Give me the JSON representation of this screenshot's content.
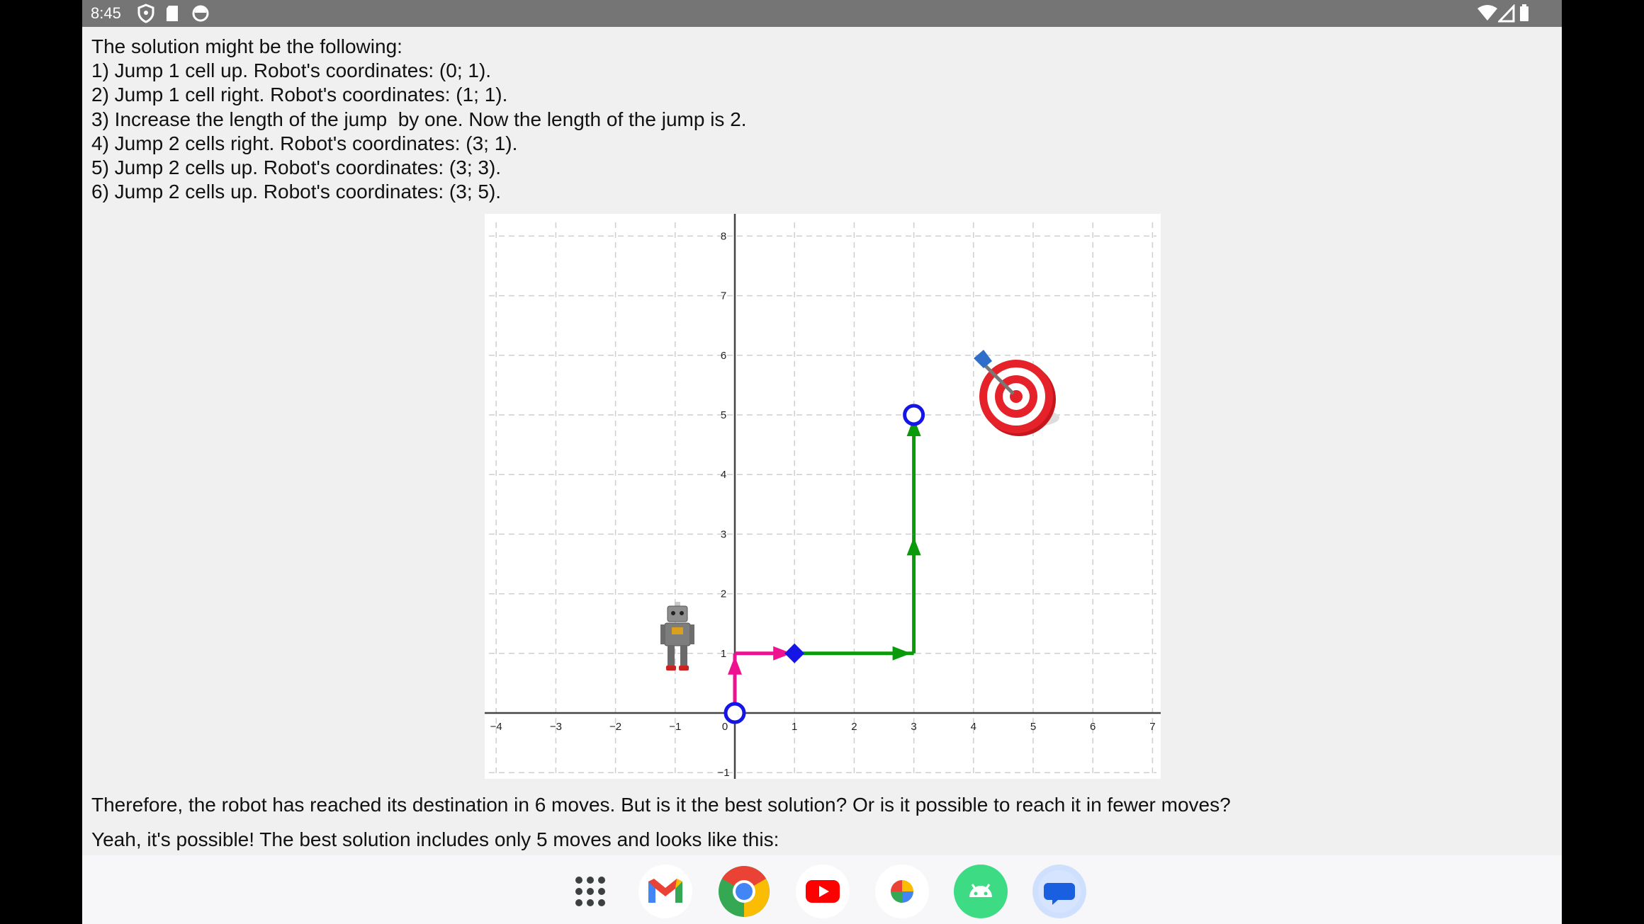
{
  "status": {
    "time": "8:45",
    "left_icons": [
      "shield-icon",
      "sd-card-icon",
      "sync-icon"
    ],
    "right_icons": [
      "wifi-icon",
      "signal-icon",
      "battery-icon"
    ]
  },
  "text": {
    "lines": [
      "The solution might be the following:",
      "1) Jump 1 cell up. Robot's coordinates: (0; 1).",
      "2) Jump 1 cell right. Robot's coordinates: (1; 1).",
      "3) Increase the length of the jump  by one. Now the length of the jump is 2.",
      "4) Jump 2 cells right. Robot's coordinates: (3; 1).",
      "5) Jump 2 cells up. Robot's coordinates: (3; 3).",
      "6) Jump 2 cells up. Robot's coordinates: (3; 5)."
    ],
    "conclusion": "Therefore, the robot has reached its destination in 6 moves. But is it the best solution? Or is it possible to reach it in fewer moves?",
    "cut_line": "Yeah, it's possible! The best solution includes only 5 moves and looks like this:"
  },
  "graph": {
    "x_ticks": [
      "-4",
      "-3",
      "-2",
      "-1",
      "0",
      "1",
      "2",
      "3",
      "4",
      "5",
      "6",
      "7"
    ],
    "y_ticks": [
      "-1",
      "1",
      "2",
      "3",
      "4",
      "5",
      "6",
      "7",
      "8"
    ],
    "path_colors": {
      "first_moves": "#ee1190",
      "later_moves": "#0a9a0a",
      "markers": "#1515e6"
    },
    "moves": [
      {
        "from": [
          0,
          0
        ],
        "to": [
          0,
          1
        ],
        "color": "first_moves"
      },
      {
        "from": [
          0,
          1
        ],
        "to": [
          1,
          1
        ],
        "color": "first_moves"
      },
      {
        "from": [
          1,
          1
        ],
        "to": [
          3,
          1
        ],
        "color": "later_moves"
      },
      {
        "from": [
          3,
          1
        ],
        "to": [
          3,
          3
        ],
        "color": "later_moves"
      },
      {
        "from": [
          3,
          3
        ],
        "to": [
          3,
          5
        ],
        "color": "later_moves"
      }
    ],
    "start_point": [
      0,
      0
    ],
    "end_point": [
      3,
      5
    ],
    "jump_change_point": [
      1,
      1
    ],
    "robot_icon": "robot-icon",
    "target_icon": "dart-target-icon"
  },
  "dock": {
    "apps": [
      "apps-grid-icon",
      "gmail-icon",
      "chrome-icon",
      "youtube-icon",
      "photos-icon",
      "android-icon",
      "messages-icon"
    ]
  }
}
